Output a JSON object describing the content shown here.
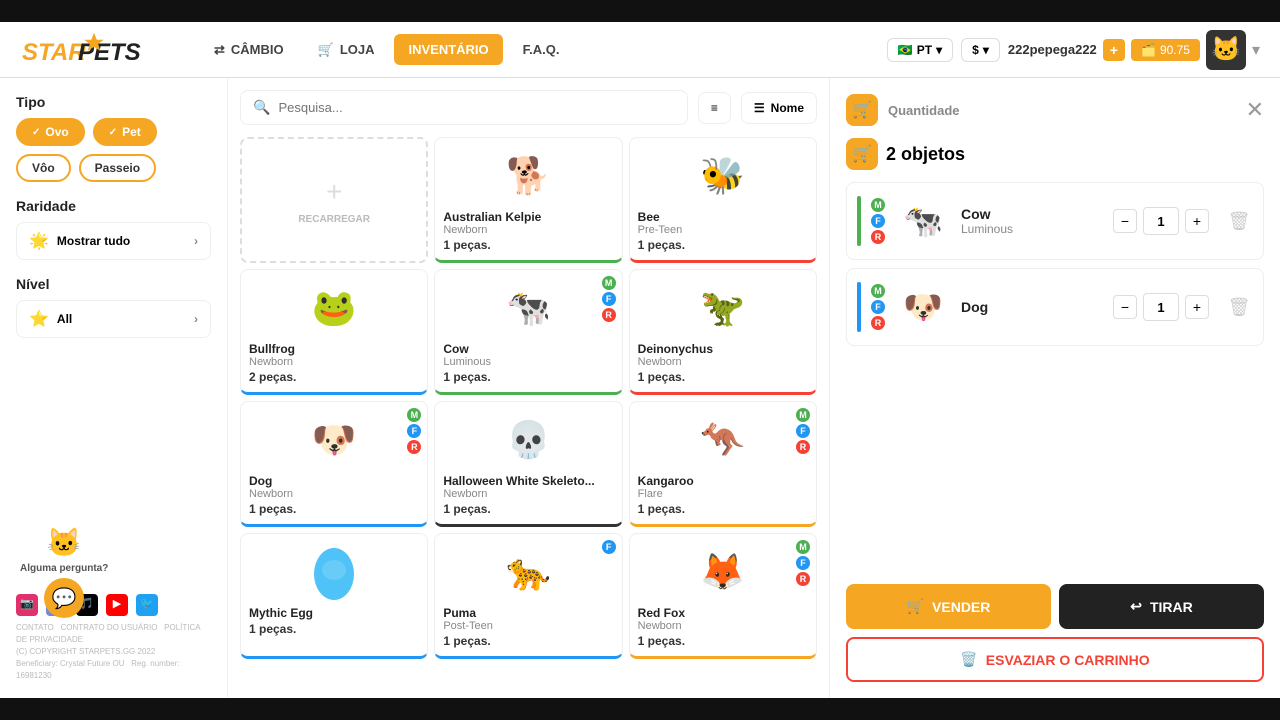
{
  "topBar": {
    "height": 22
  },
  "header": {
    "logo": "STARPETS",
    "nav": [
      {
        "id": "cambio",
        "label": "CÂMBIO",
        "icon": "⇄",
        "active": false
      },
      {
        "id": "loja",
        "label": "LOJA",
        "icon": "🛒",
        "active": false
      },
      {
        "id": "inventario",
        "label": "INVENTÁRIO",
        "icon": "",
        "active": true
      },
      {
        "id": "faq",
        "label": "F.A.Q.",
        "icon": "",
        "active": false
      }
    ],
    "currency": {
      "flag": "🇧🇷",
      "lang": "PT",
      "dollar": "$"
    },
    "user": {
      "name": "222pepega222",
      "addLabel": "+",
      "walletLabel": "90.75",
      "walletIcon": "🗂️"
    }
  },
  "sidebar": {
    "tipoTitle": "Tipo",
    "filters": [
      {
        "id": "ovo",
        "label": "Ovo",
        "active": true
      },
      {
        "id": "pet",
        "label": "Pet",
        "active": true
      },
      {
        "id": "voo",
        "label": "Vôo",
        "active": false
      },
      {
        "id": "passeio",
        "label": "Passeio",
        "active": false
      }
    ],
    "raridadeTitle": "Raridade",
    "raridadeValue": "Mostrar tudo",
    "nivelTitle": "Nível",
    "nivelValue": "All",
    "chatLabel": "Alguma pergunta?",
    "socialIcons": [
      "instagram",
      "discord",
      "tiktok",
      "youtube",
      "twitter"
    ],
    "footerLines": [
      "CONTATO",
      "CONTRATO DO USUÁRIO",
      "POLÍTICA DE PRIVACIDADE",
      "(C) COPYRIGHT",
      "STARPETS.GG 2022",
      "Beneficiary: Crystal Future OU",
      "Reg. number: 16981230"
    ]
  },
  "inventory": {
    "searchPlaceholder": "Pesquisa...",
    "sortLabel": "Nome",
    "items": [
      {
        "id": "reload",
        "type": "reload",
        "label": "RECARREGAR",
        "border": "dashed"
      },
      {
        "id": "australian-kelpie",
        "name": "Australian Kelpie",
        "sub": "Newborn",
        "count": "1 peças.",
        "border": "green",
        "emoji": "🐕",
        "badges": []
      },
      {
        "id": "bee",
        "name": "Bee",
        "sub": "Pre-Teen",
        "count": "1 peças.",
        "border": "red",
        "emoji": "🐝",
        "badges": []
      },
      {
        "id": "bullfrog",
        "name": "Bullfrog",
        "sub": "Newborn",
        "count": "2 peças.",
        "border": "blue",
        "emoji": "🐸",
        "badges": []
      },
      {
        "id": "cow",
        "name": "Cow",
        "sub": "Luminous",
        "count": "1 peças.",
        "border": "green",
        "emoji": "🐄",
        "badges": [
          "M",
          "F",
          "R"
        ]
      },
      {
        "id": "deinonychus",
        "name": "Deinonychus",
        "sub": "Newborn",
        "count": "1 peças.",
        "border": "red",
        "emoji": "🦕",
        "badges": []
      },
      {
        "id": "dog",
        "name": "Dog",
        "sub": "Newborn",
        "count": "1 peças.",
        "border": "blue",
        "emoji": "🐶",
        "badges": [
          "M",
          "F",
          "R"
        ]
      },
      {
        "id": "halloween-white-skeleton",
        "name": "Halloween White Skeleto...",
        "sub": "Newborn",
        "count": "1 peças.",
        "border": "black",
        "emoji": "💀",
        "badges": []
      },
      {
        "id": "kangaroo",
        "name": "Kangaroo",
        "sub": "Flare",
        "count": "1 peças.",
        "border": "orange",
        "emoji": "🦘",
        "badges": [
          "M",
          "F",
          "R"
        ]
      },
      {
        "id": "mythic-egg",
        "name": "Mythic Egg",
        "sub": "",
        "count": "1 peças.",
        "border": "blue",
        "emoji": "🥚",
        "badges": []
      },
      {
        "id": "puma",
        "name": "Puma",
        "sub": "Post-Teen",
        "count": "1 peças.",
        "border": "blue",
        "emoji": "🐆",
        "badges": [
          "F"
        ]
      },
      {
        "id": "red-fox",
        "name": "Red Fox",
        "sub": "Newborn",
        "count": "1 peças.",
        "border": "orange",
        "emoji": "🦊",
        "badges": [
          "M",
          "F",
          "R"
        ]
      }
    ]
  },
  "cart": {
    "countLabel": "2 objetos",
    "items": [
      {
        "id": "cart-cow",
        "name": "Cow",
        "sub": "Luminous",
        "qty": 1,
        "indicatorColor": "green",
        "emoji": "🐄",
        "badges": [
          "M",
          "F",
          "R"
        ]
      },
      {
        "id": "cart-dog",
        "name": "Dog",
        "sub": "",
        "qty": 1,
        "indicatorColor": "blue",
        "emoji": "🐶",
        "badges": [
          "M",
          "F",
          "R"
        ]
      }
    ],
    "sellLabel": "VENDER",
    "removeLabel": "TIRAR",
    "clearLabel": "ESVAZIAR O CARRINHO",
    "sellIcon": "🛒",
    "removeIcon": "↩",
    "clearIcon": "🗑️"
  }
}
